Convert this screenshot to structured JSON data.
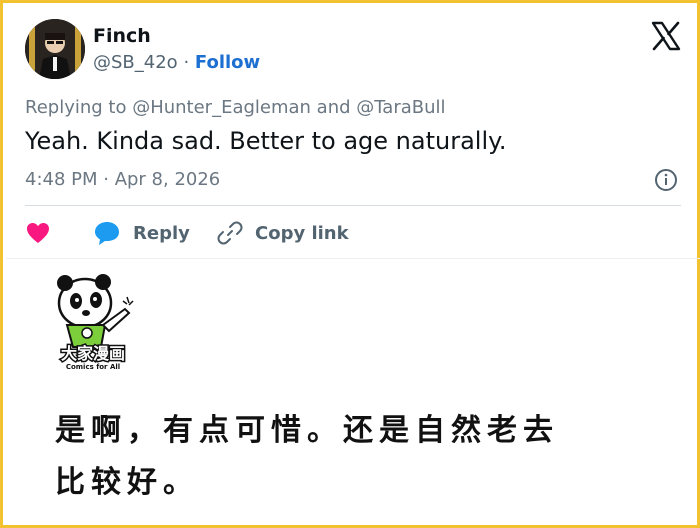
{
  "tweet": {
    "author_name": "Finch",
    "handle": "@SB_42o",
    "separator": "·",
    "follow_label": "Follow",
    "replying_to": "Replying to @Hunter_Eagleman and @TaraBull",
    "text": "Yeah. Kinda sad. Better to age naturally.",
    "timestamp": "4:48 PM · Apr 8, 2026"
  },
  "actions": {
    "reply_label": "Reply",
    "copy_link_label": "Copy link"
  },
  "icons": {
    "logo": "x-logo-icon",
    "info": "info-icon",
    "like": "heart-icon",
    "reply": "speech-bubble-icon",
    "copy": "link-icon"
  },
  "comic": {
    "logo_text": "大家漫画",
    "logo_subtext": "Comics for All",
    "translation_line1": "是啊，有点可惜。还是自然老去",
    "translation_line2": "比较好。"
  },
  "colors": {
    "frame": "#f2c230",
    "follow": "#1d6fd1",
    "heart": "#f91880",
    "reply_icon": "#1d9bf0",
    "muted": "#536471"
  }
}
